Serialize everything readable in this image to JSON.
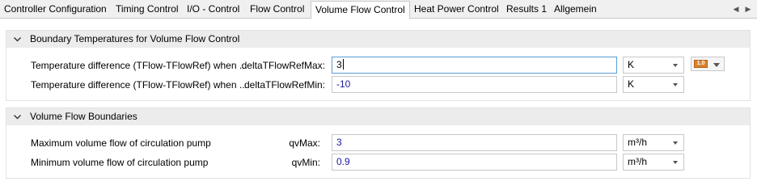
{
  "tabs": [
    {
      "label": "Controller Configuration"
    },
    {
      "label": "Timing Control"
    },
    {
      "label": "I/O - Control"
    },
    {
      "label": "Flow Control"
    },
    {
      "label": "Volume Flow Control",
      "active": true
    },
    {
      "label": "Heat Power Control"
    },
    {
      "label": "Results 1"
    },
    {
      "label": "Allgemein"
    }
  ],
  "sections": [
    {
      "title": "Boundary Temperatures for Volume Flow Control",
      "rows": [
        {
          "label": "Temperature difference (TFlow-TFlowRef) when ...",
          "param": "deltaTFlowRefMax:",
          "value": "3",
          "unit": "K",
          "focused": true
        },
        {
          "label": "Temperature difference (TFlow-TFlowRef) when ...",
          "param": "deltaTFlowRefMin:",
          "value": "-10",
          "unit": "K"
        }
      ]
    },
    {
      "title": "Volume Flow Boundaries",
      "rows": [
        {
          "label": "Maximum volume flow of circulation pump",
          "param": "qvMax:",
          "value": "3",
          "unit": "m³/h"
        },
        {
          "label": "Minimum volume flow of circulation pump",
          "param": "qvMin:",
          "value": "0.9",
          "unit": "m³/h"
        }
      ]
    }
  ],
  "variable_button": {
    "icon": "value-type-icon",
    "icon_text": "1.0"
  },
  "colors": {
    "value_text": "#1a1aa0",
    "focus_border": "#5b9bd5",
    "header_bg": "#ececec",
    "icon_orange": "#d9822b"
  }
}
